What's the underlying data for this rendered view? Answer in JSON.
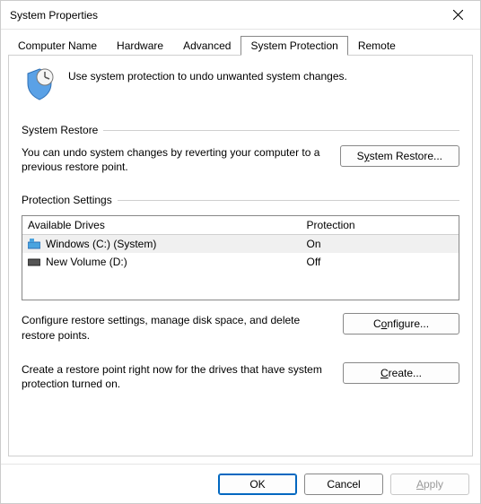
{
  "window": {
    "title": "System Properties"
  },
  "tabs": {
    "items": [
      {
        "label": "Computer Name"
      },
      {
        "label": "Hardware"
      },
      {
        "label": "Advanced"
      },
      {
        "label": "System Protection"
      },
      {
        "label": "Remote"
      }
    ],
    "active_index": 3
  },
  "intro": {
    "text": "Use system protection to undo unwanted system changes."
  },
  "system_restore": {
    "group_label": "System Restore",
    "description": "You can undo system changes by reverting your computer to a previous restore point.",
    "button_prefix": "S",
    "button_accel": "y",
    "button_suffix": "stem Restore..."
  },
  "protection": {
    "group_label": "Protection Settings",
    "headers": {
      "drives": "Available Drives",
      "protection": "Protection"
    },
    "rows": [
      {
        "name": "Windows (C:) (System)",
        "status": "On",
        "selected": true,
        "icon": "drive-system"
      },
      {
        "name": "New Volume (D:)",
        "status": "Off",
        "selected": false,
        "icon": "drive"
      }
    ],
    "configure": {
      "description": "Configure restore settings, manage disk space, and delete restore points.",
      "button_prefix": "C",
      "button_accel": "o",
      "button_suffix": "nfigure..."
    },
    "create": {
      "description": "Create a restore point right now for the drives that have system protection turned on.",
      "button_prefix": "",
      "button_accel": "C",
      "button_suffix": "reate..."
    }
  },
  "footer": {
    "ok": "OK",
    "cancel": "Cancel",
    "apply_prefix": "",
    "apply_accel": "A",
    "apply_suffix": "pply",
    "apply_enabled": false
  }
}
